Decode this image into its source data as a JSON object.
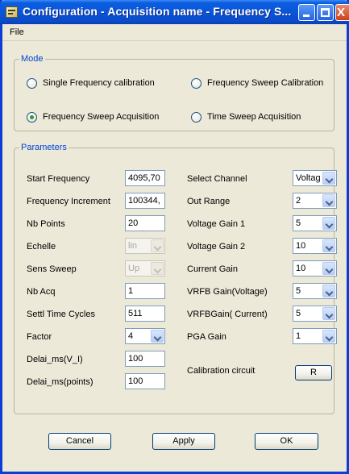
{
  "window": {
    "title": "Configuration - Acquisition name  - Frequency S...",
    "min_glyph": "",
    "max_glyph": "",
    "close_glyph": "X"
  },
  "menu": {
    "file": "File"
  },
  "mode": {
    "label": "Mode",
    "options": [
      {
        "label": "Single Frequency calibration",
        "checked": false
      },
      {
        "label": "Frequency Sweep Calibration",
        "checked": false
      },
      {
        "label": "Frequency Sweep Acquisition",
        "checked": true
      },
      {
        "label": "Time Sweep Acquisition",
        "checked": false
      }
    ]
  },
  "parameters": {
    "label": "Parameters",
    "left": [
      {
        "label": "Start Frequency",
        "value": "4095,70"
      },
      {
        "label": "Frequency Increment",
        "value": "100344,"
      },
      {
        "label": "Nb Points",
        "value": "20"
      },
      {
        "label": "Echelle",
        "value": "lin"
      },
      {
        "label": "Sens Sweep",
        "value": "Up"
      },
      {
        "label": "Nb Acq",
        "value": "1"
      },
      {
        "label": "Settl Time Cycles",
        "value": "511"
      },
      {
        "label": "Factor",
        "value": "4"
      },
      {
        "label": "Delai_ms(V_I)",
        "value": "100"
      },
      {
        "label": "Delai_ms(points)",
        "value": "100"
      }
    ],
    "right": [
      {
        "label": "Select Channel",
        "value": "Voltag"
      },
      {
        "label": "Out Range",
        "value": "2"
      },
      {
        "label": "Voltage Gain 1",
        "value": "5"
      },
      {
        "label": "Voltage Gain 2",
        "value": "10"
      },
      {
        "label": "Current Gain",
        "value": "10"
      },
      {
        "label": "VRFB Gain(Voltage)",
        "value": "5"
      },
      {
        "label": "VRFBGain( Current)",
        "value": "5"
      },
      {
        "label": "PGA Gain",
        "value": "1"
      },
      {
        "label": "Calibration circuit",
        "value": "R"
      }
    ]
  },
  "buttons": {
    "cancel": "Cancel",
    "apply": "Apply",
    "ok": "OK"
  }
}
